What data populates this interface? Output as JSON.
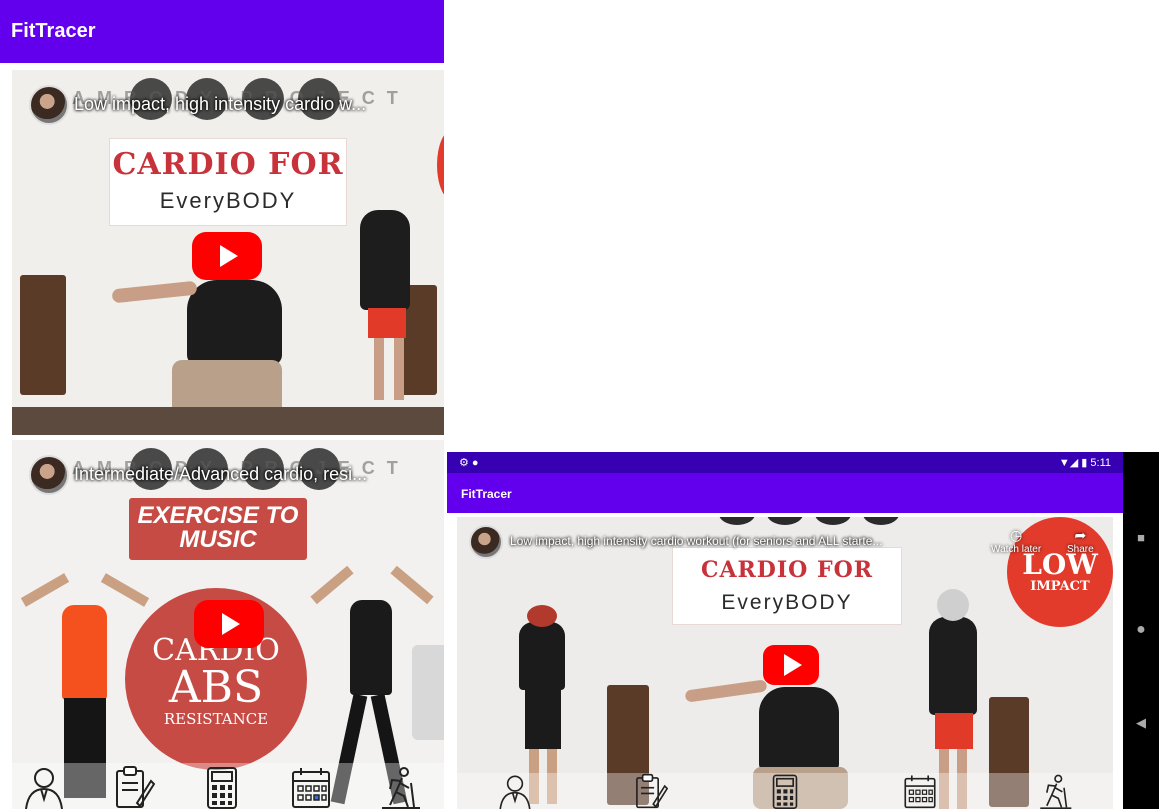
{
  "left_app": {
    "title": "FitTracer",
    "videos": [
      {
        "title": "Low impact, high intensity cardio w...",
        "channel_banner": "AMBODY PROJECT",
        "sign_line1": "CARDIO FOR",
        "sign_line2": "EveryBODY"
      },
      {
        "title": "Intermediate/Advanced cardio, resi...",
        "channel_banner": "AMBODY PROJECT",
        "sign_line1": "EXERCISE TO",
        "sign_line2": "MUSIC",
        "circle_line1": "CARDIO",
        "circle_line2": "ABS",
        "circle_line3": "RESISTANCE"
      }
    ]
  },
  "right_app": {
    "status_time": "5:11",
    "title": "FitTracer",
    "video": {
      "title": "Low impact, high intensity cardio workout (for seniors and ALL starte...",
      "watch_later": "Watch later",
      "share": "Share",
      "sign_line1": "CARDIO FOR",
      "sign_line2": "EveryBODY",
      "badge_line1": "LOW",
      "badge_line2": "IMPACT"
    }
  },
  "bottom_nav": [
    {
      "icon": "trainer-icon",
      "label": "Trainer"
    },
    {
      "icon": "clipboard-icon",
      "label": "Notes"
    },
    {
      "icon": "calculator-icon",
      "label": "Calculator"
    },
    {
      "icon": "calendar-icon",
      "label": "Calendar"
    },
    {
      "icon": "hiker-icon",
      "label": "Activity"
    }
  ],
  "colors": {
    "primary": "#6200ee",
    "primary_dark": "#3700b3",
    "play_red": "#ff0000",
    "sign_red": "#c8323a"
  }
}
